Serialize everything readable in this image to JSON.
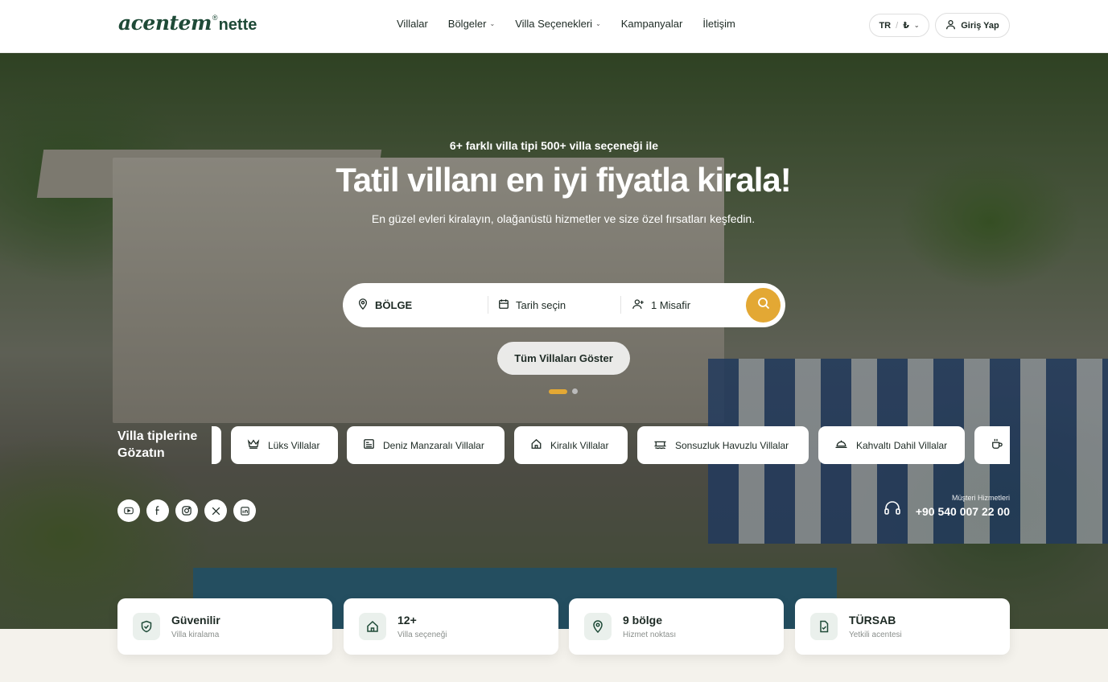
{
  "header": {
    "logo_main": "acentem",
    "logo_mark": "®",
    "logo_suffix": "nette",
    "nav": [
      {
        "label": "Villalar"
      },
      {
        "label": "Bölgeler"
      },
      {
        "label": "Villa Seçenekleri"
      },
      {
        "label": "Kampanyalar"
      },
      {
        "label": "İletişim"
      }
    ],
    "language": "TR",
    "currency": "₺",
    "login_label": "Giriş Yap"
  },
  "hero": {
    "eyebrow": "6+ farklı villa tipi 500+ villa seçeneği ile",
    "title": "Tatil villanı en iyi fiyatla kirala!",
    "subtitle": "En güzel evleri kiralayın, olağanüstü hizmetler ve size özel fırsatları keşfedin.",
    "search": {
      "region": "BÖLGE",
      "date": "Tarih seçin",
      "guests": "1 Misafir"
    },
    "show_all_label": "Tüm Villaları Göster",
    "carousel": {
      "active": 1,
      "count": 2
    }
  },
  "villa_types": {
    "title_line1": "Villa tiplerine",
    "title_line2": "Gözatın",
    "items": [
      {
        "label": "Lüks Villalar",
        "icon": "crown-icon"
      },
      {
        "label": "Deniz Manzaralı Villalar",
        "icon": "sea-view-icon"
      },
      {
        "label": "Kiralık Villalar",
        "icon": "house-icon"
      },
      {
        "label": "Sonsuzluk Havuzlu Villalar",
        "icon": "pool-icon"
      },
      {
        "label": "Kahvaltı Dahil Villalar",
        "icon": "breakfast-icon"
      },
      {
        "label": "",
        "icon": "coffee-icon"
      }
    ]
  },
  "social": [
    "youtube-icon",
    "facebook-icon",
    "instagram-icon",
    "x-icon",
    "linkedin-icon"
  ],
  "support": {
    "label": "Müşteri Hizmetleri",
    "phone": "+90 540 007 22 00"
  },
  "stats": [
    {
      "title": "Güvenilir",
      "subtitle": "Villa kiralama",
      "icon": "shield-icon"
    },
    {
      "title": "12+",
      "subtitle": "Villa seçeneği",
      "icon": "home-icon"
    },
    {
      "title": "9 bölge",
      "subtitle": "Hizmet noktası",
      "icon": "location-icon"
    },
    {
      "title": "TÜRSAB",
      "subtitle": "Yetkili acentesi",
      "icon": "document-icon"
    }
  ],
  "colors": {
    "accent": "#e3a834",
    "brand": "#1e4a37",
    "text": "#1d2a24",
    "page_bg": "#f4f2ec"
  }
}
